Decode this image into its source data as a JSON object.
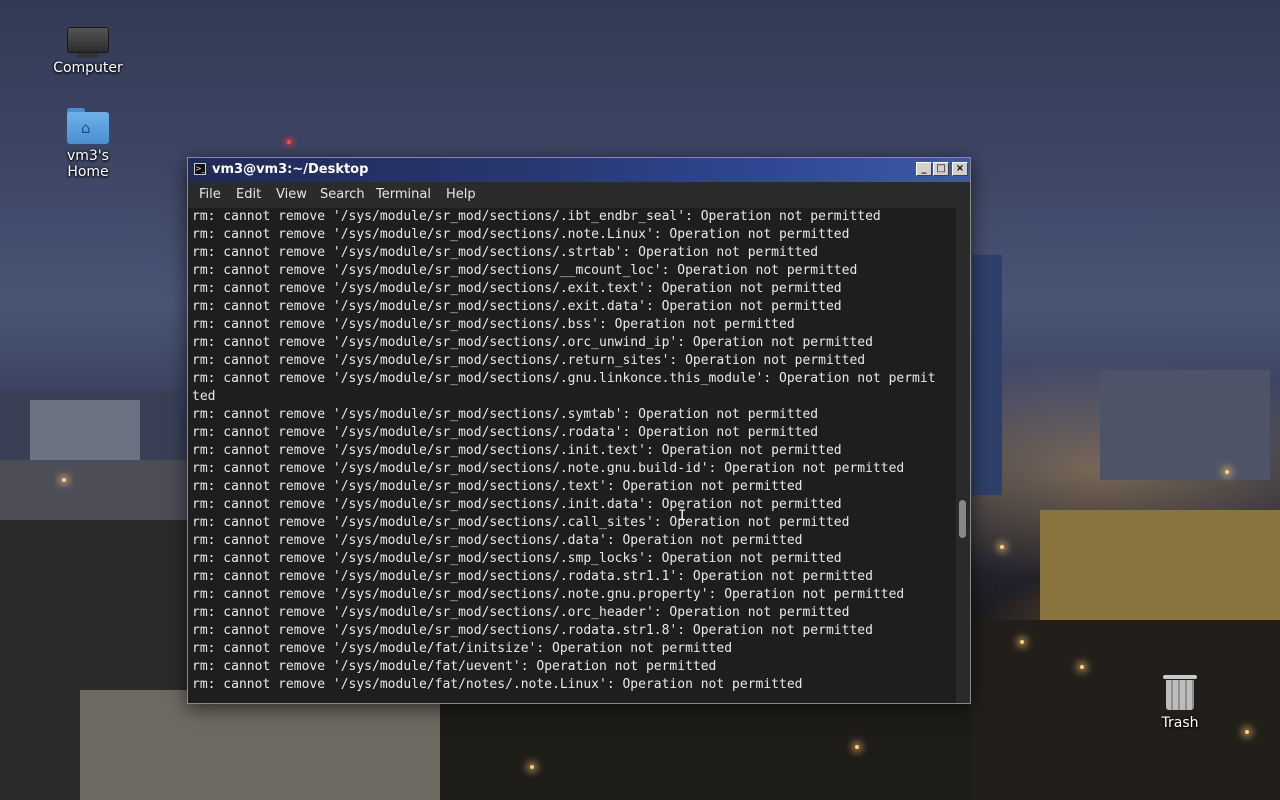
{
  "desktop": {
    "icons": [
      {
        "label": "Computer",
        "icon": "computer-icon"
      },
      {
        "label": "vm3's Home",
        "icon": "home-folder-icon"
      },
      {
        "label": "Trash",
        "icon": "trash-icon"
      }
    ]
  },
  "window": {
    "title": "vm3@vm3:~/Desktop",
    "controls": {
      "minimize": "_",
      "maximize": "□",
      "close": "×"
    },
    "menu": [
      "File",
      "Edit",
      "View",
      "Search",
      "Terminal",
      "Help"
    ],
    "terminal_lines": [
      "rm: cannot remove '/sys/module/sr_mod/sections/.ibt_endbr_seal': Operation not permitted",
      "rm: cannot remove '/sys/module/sr_mod/sections/.note.Linux': Operation not permitted",
      "rm: cannot remove '/sys/module/sr_mod/sections/.strtab': Operation not permitted",
      "rm: cannot remove '/sys/module/sr_mod/sections/__mcount_loc': Operation not permitted",
      "rm: cannot remove '/sys/module/sr_mod/sections/.exit.text': Operation not permitted",
      "rm: cannot remove '/sys/module/sr_mod/sections/.exit.data': Operation not permitted",
      "rm: cannot remove '/sys/module/sr_mod/sections/.bss': Operation not permitted",
      "rm: cannot remove '/sys/module/sr_mod/sections/.orc_unwind_ip': Operation not permitted",
      "rm: cannot remove '/sys/module/sr_mod/sections/.return_sites': Operation not permitted",
      "rm: cannot remove '/sys/module/sr_mod/sections/.gnu.linkonce.this_module': Operation not permit",
      "ted",
      "rm: cannot remove '/sys/module/sr_mod/sections/.symtab': Operation not permitted",
      "rm: cannot remove '/sys/module/sr_mod/sections/.rodata': Operation not permitted",
      "rm: cannot remove '/sys/module/sr_mod/sections/.init.text': Operation not permitted",
      "rm: cannot remove '/sys/module/sr_mod/sections/.note.gnu.build-id': Operation not permitted",
      "rm: cannot remove '/sys/module/sr_mod/sections/.text': Operation not permitted",
      "rm: cannot remove '/sys/module/sr_mod/sections/.init.data': Operation not permitted",
      "rm: cannot remove '/sys/module/sr_mod/sections/.call_sites': Operation not permitted",
      "rm: cannot remove '/sys/module/sr_mod/sections/.data': Operation not permitted",
      "rm: cannot remove '/sys/module/sr_mod/sections/.smp_locks': Operation not permitted",
      "rm: cannot remove '/sys/module/sr_mod/sections/.rodata.str1.1': Operation not permitted",
      "rm: cannot remove '/sys/module/sr_mod/sections/.note.gnu.property': Operation not permitted",
      "rm: cannot remove '/sys/module/sr_mod/sections/.orc_header': Operation not permitted",
      "rm: cannot remove '/sys/module/sr_mod/sections/.rodata.str1.8': Operation not permitted",
      "rm: cannot remove '/sys/module/fat/initsize': Operation not permitted",
      "rm: cannot remove '/sys/module/fat/uevent': Operation not permitted",
      "rm: cannot remove '/sys/module/fat/notes/.note.Linux': Operation not permitted"
    ]
  }
}
